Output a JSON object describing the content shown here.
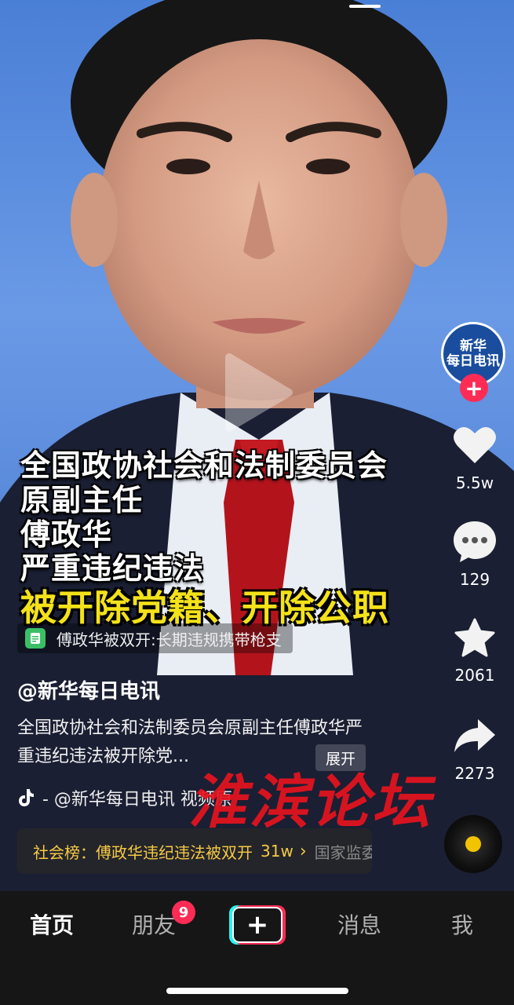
{
  "video": {
    "captions": [
      "全国政协社会和法制委员会",
      "原副主任",
      "傅政华",
      "严重违纪违法"
    ],
    "highlight": "被开除党籍、开除公职",
    "related": "傅政华被双开:长期违规携带枪支"
  },
  "creator": {
    "avatar_line1": "新华",
    "avatar_line2": "每日电讯",
    "handle": "@新华每日电讯"
  },
  "actions": {
    "likes": "5.5w",
    "comments": "129",
    "favorites": "2061",
    "shares": "2273"
  },
  "post": {
    "description": "全国政协社会和法制委员会原副主任傅政华严重违纪违法被开除党...",
    "expand_label": "展开",
    "music": "- @新华每日电讯 视频原",
    "hot_label": "社会榜：傅政华违纪违法被双开",
    "hot_count": "31w",
    "hot_tail": "国家监委网"
  },
  "watermark": "淮滨论坛",
  "nav": {
    "home": "首页",
    "friends": "朋友",
    "friends_badge": "9",
    "create": "+",
    "messages": "消息",
    "me": "我"
  },
  "colors": {
    "accent_red": "#fe2c55",
    "accent_cyan": "#25f4ee",
    "caption_yellow": "#f4e21a",
    "hot_gold": "#f6c945"
  }
}
